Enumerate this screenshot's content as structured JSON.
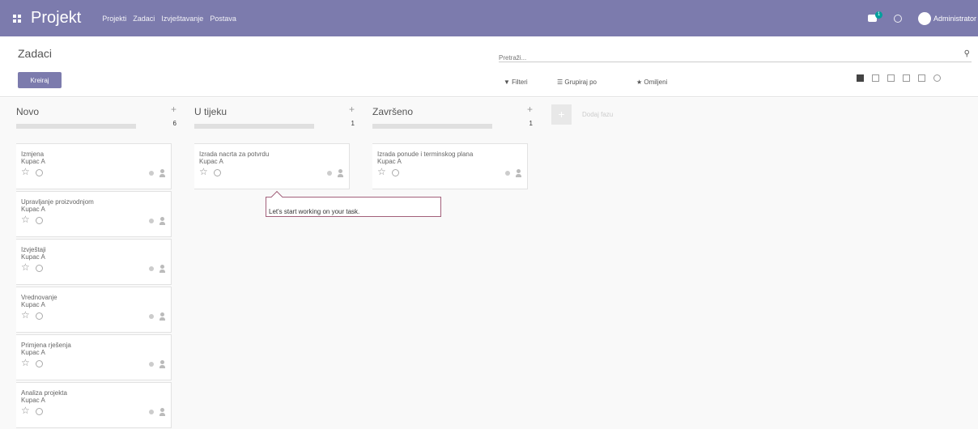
{
  "app": {
    "title": "Projekt"
  },
  "menu": [
    "Projekti",
    "Zadaci",
    "Izvještavanje",
    "Postava"
  ],
  "top_right": {
    "chat_badge": "1",
    "user": "Administrator"
  },
  "control_panel": {
    "breadcrumb": "Zadaci",
    "create_label": "Kreiraj",
    "search_placeholder": "Pretraži...",
    "filters_label": "▼ Filteri",
    "groupby_label": "☰ Grupiraj po",
    "favorites_label": "★ Omiljeni"
  },
  "views": [
    "kanban",
    "list",
    "calendar",
    "pivot",
    "graph",
    "activity"
  ],
  "columns": [
    {
      "title": "Novo",
      "count": "6",
      "cards": [
        {
          "title": "Izmjena",
          "customer": "Kupac A"
        },
        {
          "title": "Upravljanje proizvodnjom",
          "customer": "Kupac A"
        },
        {
          "title": "Izvještaji",
          "customer": "Kupac A"
        },
        {
          "title": "Vrednovanje",
          "customer": "Kupac A"
        },
        {
          "title": "Primjena rješenja",
          "customer": "Kupac A"
        },
        {
          "title": "Analiza projekta",
          "customer": "Kupac A"
        }
      ]
    },
    {
      "title": "U tijeku",
      "count": "1",
      "cards": [
        {
          "title": "Izrada nacrta za potvrdu",
          "customer": "Kupac A"
        }
      ]
    },
    {
      "title": "Završeno",
      "count": "1",
      "cards": [
        {
          "title": "Izrada ponude i terminskog plana",
          "customer": "Kupac A"
        }
      ]
    }
  ],
  "add_stage_label": "Dodaj fazu",
  "tooltip": "Let's start working on your task."
}
